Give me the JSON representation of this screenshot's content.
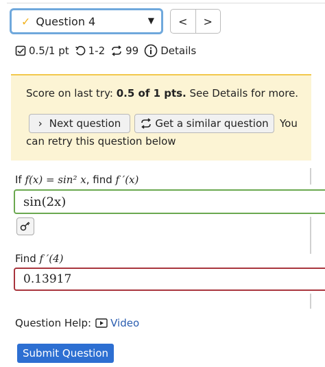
{
  "question_selector": {
    "label": "Question 4",
    "status_icon": "check-icon",
    "caret": "▼"
  },
  "nav": {
    "prev": "<",
    "next": ">"
  },
  "status": {
    "points": "0.5/1 pt",
    "attempts": "1-2",
    "retries": "99",
    "details": "Details"
  },
  "score": {
    "prefix": "Score on last try: ",
    "value": "0.5 of 1 pts.",
    "suffix": " See Details for more.",
    "next_button": "Next question",
    "similar_button": "Get a similar question",
    "you": "You",
    "retry_text": "can retry this question below"
  },
  "part1": {
    "prompt_if": "If ",
    "prompt_fx": "f(x) = sin² x",
    "prompt_find": ", find ",
    "prompt_target": "f ′(x)",
    "answer": "sin(2x)",
    "key_icon": "key-icon"
  },
  "part2": {
    "prompt_find": "Find ",
    "prompt_target": "f ′(4)",
    "answer": "0.13917"
  },
  "help": {
    "label": "Question Help:",
    "video": "Video"
  },
  "submit_label": "Submit Question",
  "colors": {
    "accent_blue": "#2d6fd2",
    "correct_green": "#6aa84f",
    "incorrect_red": "#a8343c",
    "score_bg": "#fcf4d4"
  }
}
